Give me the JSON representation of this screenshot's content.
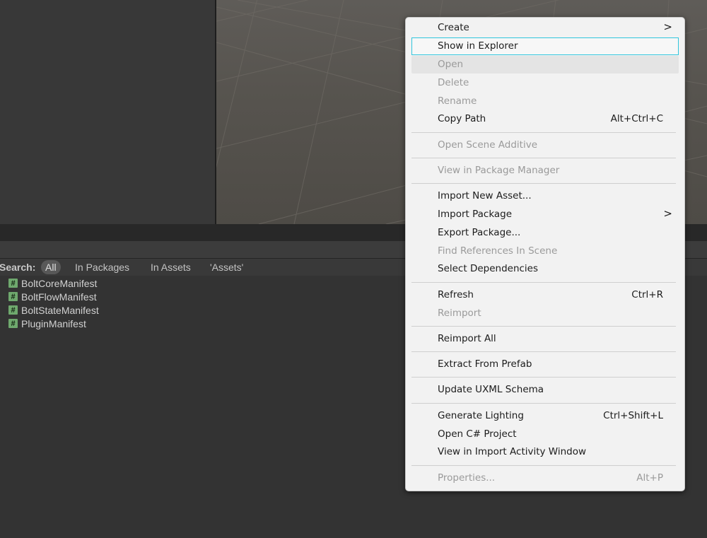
{
  "search": {
    "label": "Search:",
    "filters": [
      "All",
      "In Packages",
      "In Assets",
      "'Assets'"
    ]
  },
  "assets": [
    {
      "name": "BoltCoreManifest",
      "icon": "script-icon"
    },
    {
      "name": "BoltFlowManifest",
      "icon": "script-icon"
    },
    {
      "name": "BoltStateManifest",
      "icon": "script-icon"
    },
    {
      "name": "PluginManifest",
      "icon": "script-icon"
    }
  ],
  "context_menu": {
    "items": {
      "create": {
        "label": "Create",
        "arrow": ">"
      },
      "show_in_explorer": {
        "label": "Show in Explorer"
      },
      "open": {
        "label": "Open"
      },
      "delete": {
        "label": "Delete"
      },
      "rename": {
        "label": "Rename"
      },
      "copy_path": {
        "label": "Copy Path",
        "shortcut": "Alt+Ctrl+C"
      },
      "open_scene_additive": {
        "label": "Open Scene Additive"
      },
      "view_in_package_manager": {
        "label": "View in Package Manager"
      },
      "import_new_asset": {
        "label": "Import New Asset..."
      },
      "import_package": {
        "label": "Import Package",
        "arrow": ">"
      },
      "export_package": {
        "label": "Export Package..."
      },
      "find_references": {
        "label": "Find References In Scene"
      },
      "select_dependencies": {
        "label": "Select Dependencies"
      },
      "refresh": {
        "label": "Refresh",
        "shortcut": "Ctrl+R"
      },
      "reimport": {
        "label": "Reimport"
      },
      "reimport_all": {
        "label": "Reimport All"
      },
      "extract_from_prefab": {
        "label": "Extract From Prefab"
      },
      "update_uxml_schema": {
        "label": "Update UXML Schema"
      },
      "generate_lighting": {
        "label": "Generate Lighting",
        "shortcut": "Ctrl+Shift+L"
      },
      "open_csharp_project": {
        "label": "Open C# Project"
      },
      "view_in_import_activity": {
        "label": "View in Import Activity Window"
      },
      "properties": {
        "label": "Properties...",
        "shortcut": "Alt+P"
      }
    }
  },
  "colors": {
    "focus_outline": "#30c5dd",
    "menu_background": "#f2f2f2",
    "disabled_text": "#9a9a9a",
    "script_icon": "#6fa96e"
  }
}
